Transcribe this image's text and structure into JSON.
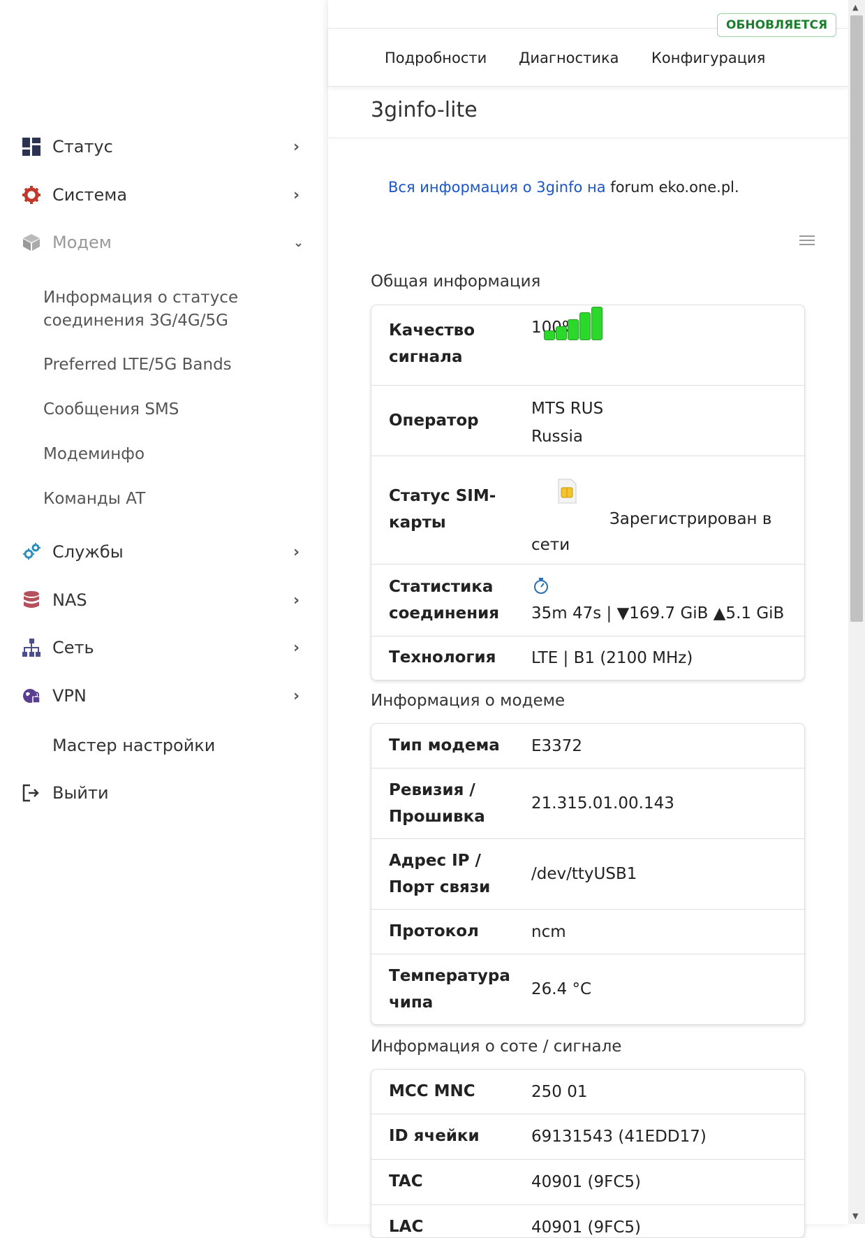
{
  "sidebar": {
    "items": [
      {
        "label": "Статус",
        "icon": "dashboard-icon"
      },
      {
        "label": "Система",
        "icon": "gear-icon"
      },
      {
        "label": "Модем",
        "icon": "cube-icon"
      },
      {
        "label": "Службы",
        "icon": "cogs-icon"
      },
      {
        "label": "NAS",
        "icon": "database-icon"
      },
      {
        "label": "Сеть",
        "icon": "sitemap-icon"
      },
      {
        "label": "VPN",
        "icon": "globe-lock-icon"
      }
    ],
    "modem_subitems": [
      "Информация о статусе соединения 3G/4G/5G",
      "Preferred LTE/5G Bands",
      "Сообщения SMS",
      "Модеминфо",
      "Команды AT"
    ],
    "wizard_label": "Мастер настройки",
    "logout_label": "Выйти"
  },
  "header": {
    "status_badge": "ОБНОВЛЯЕТСЯ",
    "tabs": [
      "Подробности",
      "Диагностика",
      "Конфигурация"
    ]
  },
  "page": {
    "title": "3ginfo-lite",
    "info_link": "Вся информация о 3ginfo на",
    "info_text": "forum eko.one.pl."
  },
  "general": {
    "title": "Общая информация",
    "signal_label": "Качество сигнала",
    "signal_value": "100%",
    "signal_level": 1.0,
    "operator_label": "Оператор",
    "operator_value": "MTS RUS",
    "operator_country": "Russia",
    "sim_label": "Статус SIM-карты",
    "sim_value": "Зарегистрирован в сети",
    "stats_label": "Статистика соединения",
    "stats_value": "35m 47s | ▼169.7 GiB ▲5.1 GiB",
    "tech_label": "Технология",
    "tech_value": "LTE | B1 (2100 MHz)"
  },
  "modem": {
    "title": "Информация о модеме",
    "rows": [
      {
        "label": "Тип модема",
        "value": "E3372"
      },
      {
        "label": "Ревизия / Прошивка",
        "value": "21.315.01.00.143"
      },
      {
        "label": "Адрес IP / Порт связи",
        "value": "/dev/ttyUSB1"
      },
      {
        "label": "Протокол",
        "value": "ncm"
      },
      {
        "label": "Температура чипа",
        "value": "26.4 °C"
      }
    ]
  },
  "cell": {
    "title": "Информация о соте / сигнале",
    "rows": [
      {
        "label": "MCC MNC",
        "value": "250 01"
      },
      {
        "label": "ID ячейки",
        "value": "69131543 (41EDD17)"
      },
      {
        "label": "TAC",
        "value": "40901 (9FC5)"
      },
      {
        "label": "LAC",
        "value": "40901 (9FC5)"
      }
    ]
  },
  "colors": {
    "accent_link": "#1a55c9",
    "badge_green": "#1c7f2e",
    "signal_green": "#2bd92b"
  }
}
